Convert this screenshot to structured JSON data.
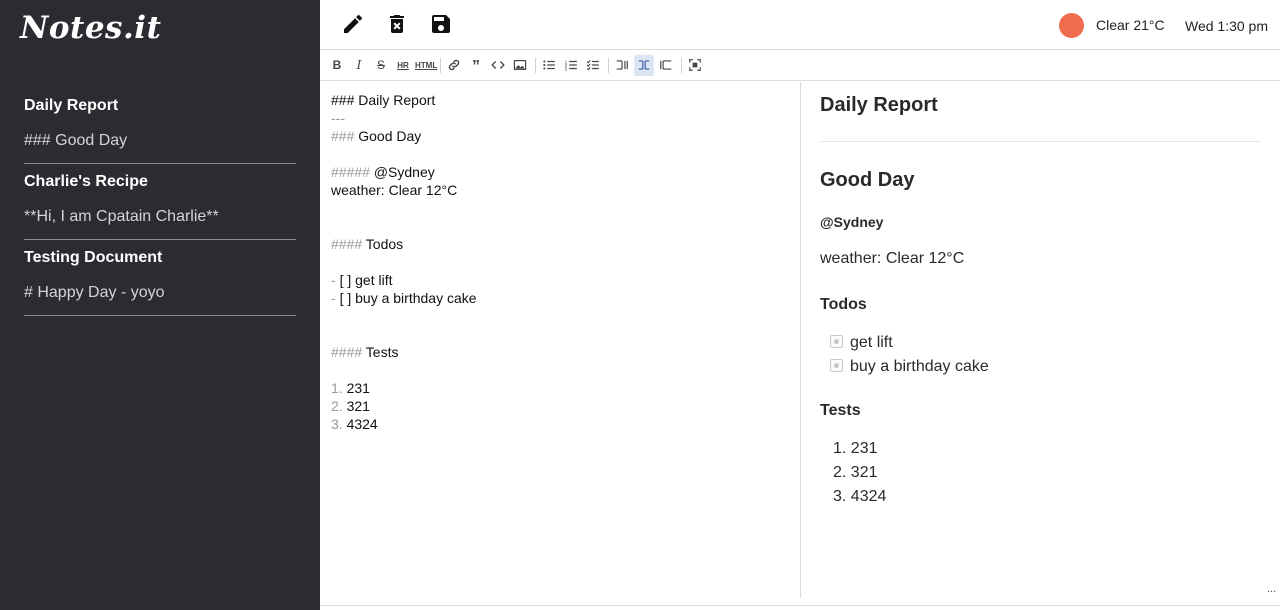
{
  "app": {
    "logo": "Notes.it"
  },
  "sidebar": {
    "notes": [
      {
        "title": "Daily Report",
        "preview": "### Good Day"
      },
      {
        "title": "Charlie's Recipe",
        "preview": "**Hi, I am Cpatain Charlie**"
      },
      {
        "title": "Testing Document",
        "preview": "# Happy Day - yoyo"
      }
    ]
  },
  "topbar": {
    "icons": [
      "pencil-icon",
      "trash-icon",
      "save-icon"
    ],
    "weather": "Clear 21°C",
    "weather_color": "#ef6c4d",
    "datetime": "Wed 1:30 pm"
  },
  "editor": {
    "lines": [
      {
        "mark": "",
        "text": "### Daily Report"
      },
      {
        "mark": "---",
        "text": ""
      },
      {
        "mark": "### ",
        "text": "Good Day"
      },
      {
        "mark": "",
        "text": ""
      },
      {
        "mark": "##### ",
        "text": "@Sydney"
      },
      {
        "mark": "",
        "text": "weather: Clear 12°C"
      },
      {
        "mark": "",
        "text": ""
      },
      {
        "mark": "",
        "text": ""
      },
      {
        "mark": "#### ",
        "text": "Todos"
      },
      {
        "mark": "",
        "text": ""
      },
      {
        "mark": "- ",
        "text": "[ ] get lift"
      },
      {
        "mark": "- ",
        "text": "[ ] buy a birthday cake"
      },
      {
        "mark": "",
        "text": ""
      },
      {
        "mark": "",
        "text": ""
      },
      {
        "mark": "#### ",
        "text": "Tests"
      },
      {
        "mark": "",
        "text": ""
      },
      {
        "mark": "1. ",
        "text": "231"
      },
      {
        "mark": "2. ",
        "text": "321"
      },
      {
        "mark": "3. ",
        "text": "4324"
      }
    ]
  },
  "preview": {
    "heading1": "Daily Report",
    "heading2": "Good Day",
    "location": "@Sydney",
    "weather": "weather: Clear 12°C",
    "todos_heading": "Todos",
    "todos": [
      "get lift",
      "buy a birthday cake"
    ],
    "tests_heading": "Tests",
    "tests": [
      "1. 231",
      "2. 321",
      "3. 4324"
    ]
  },
  "misc": {
    "ellipsis": "..."
  }
}
